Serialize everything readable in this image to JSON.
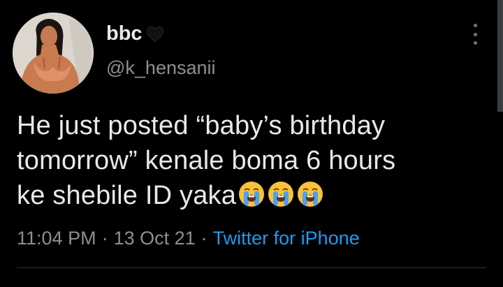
{
  "user": {
    "display_name": "bbc",
    "handle": "@k_hensanii"
  },
  "tweet": {
    "text_lines": [
      "He just posted “baby’s birthday",
      "tomorrow” kenale  boma 6 hours",
      "ke shebile ID yaka"
    ],
    "emoji_count": 3,
    "emoji_name": "loudly-crying-face"
  },
  "meta": {
    "time": "11:04 PM",
    "separator": "·",
    "date": "13 Oct 21",
    "source": "Twitter for iPhone"
  },
  "colors": {
    "background": "#000000",
    "text": "#e7e9ea",
    "secondary": "#8b8f94",
    "link": "#1d9bf0"
  }
}
